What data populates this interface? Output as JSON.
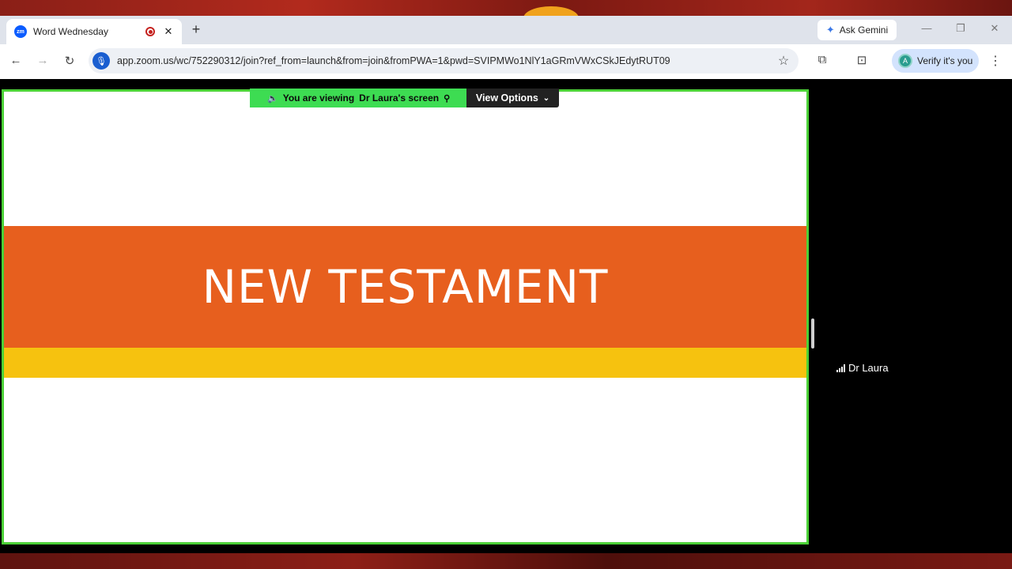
{
  "tab": {
    "favicon": "zm",
    "title": "Word Wednesday",
    "recording_icon": "record-icon",
    "close": "✕",
    "new_tab": "+"
  },
  "toolbar": {
    "ask_gemini": "Ask Gemini",
    "url": "app.zoom.us/wc/752290312/join?ref_from=launch&from=join&fromPWA=1&pwd=SVIPMWo1NlY1aGRmVWxCSkJEdytRUT09",
    "verify_label": "Verify it's you",
    "verify_avatar": "A"
  },
  "meeting": {
    "viewing_prefix": "You are viewing",
    "viewing_name": "Dr Laura's screen",
    "view_options": "View Options",
    "participant_name": "Dr Laura"
  },
  "slide": {
    "title": "NEW TESTAMENT"
  },
  "colors": {
    "slide_orange": "#e75f1e",
    "slide_yellow": "#f6c20f",
    "share_border": "#4cd137",
    "zoom_blue": "#0b5cff"
  }
}
